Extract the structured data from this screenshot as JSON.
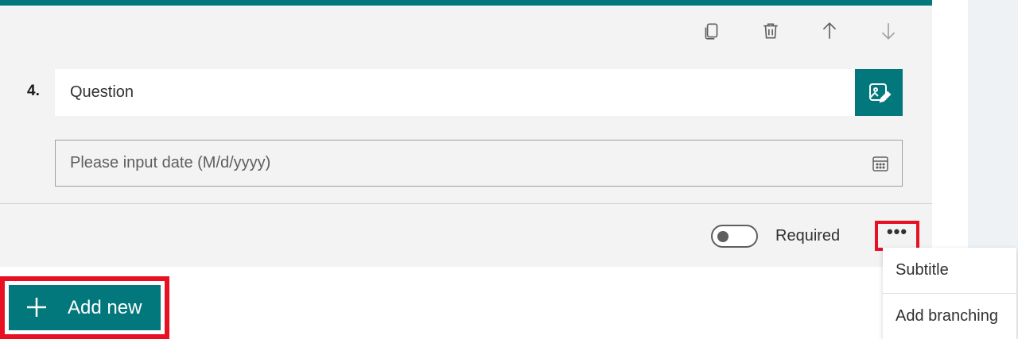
{
  "colors": {
    "accent": "#03787c",
    "highlight": "#e81123",
    "card_bg": "#f3f3f3"
  },
  "toolbar": {
    "icons": [
      "copy-icon",
      "trash-icon",
      "arrow-up-icon",
      "arrow-down-icon"
    ]
  },
  "question": {
    "number": "4.",
    "placeholder": "Question",
    "image_button_icon": "image-edit-icon"
  },
  "date_field": {
    "placeholder": "Please input date (M/d/yyyy)",
    "icon": "calendar-icon"
  },
  "footer": {
    "required_label": "Required",
    "required_on": false,
    "more_label": "•••"
  },
  "more_menu": {
    "items": [
      {
        "label": "Subtitle"
      },
      {
        "label": "Add branching"
      }
    ]
  },
  "add_new": {
    "label": "Add new",
    "icon": "plus-icon"
  }
}
